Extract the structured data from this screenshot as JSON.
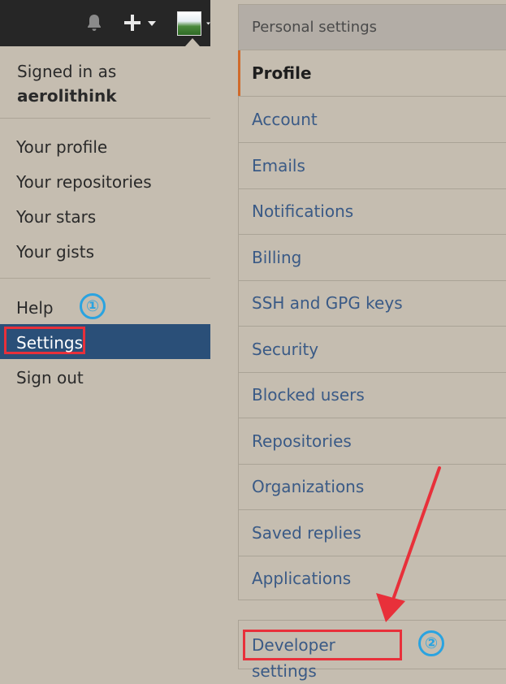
{
  "header": {
    "icons": [
      "bell-icon",
      "plus-icon",
      "chevron-down-icon",
      "avatar"
    ]
  },
  "dropdown": {
    "signed_in_label": "Signed in as",
    "username": "aerolithink",
    "items": [
      "Your profile",
      "Your repositories",
      "Your stars",
      "Your gists"
    ],
    "help": "Help",
    "settings": "Settings",
    "sign_out": "Sign out",
    "active_color": "#2a4f78"
  },
  "menu": {
    "heading": "Personal settings",
    "items": [
      "Profile",
      "Account",
      "Emails",
      "Notifications",
      "Billing",
      "SSH and GPG keys",
      "Security",
      "Blocked users",
      "Repositories",
      "Organizations",
      "Saved replies",
      "Applications"
    ],
    "selected": "Profile",
    "developer_settings": "Developer settings"
  },
  "annotations": {
    "step1": "①",
    "step2": "②",
    "highlight_color": "#e8303a",
    "badge_color": "#2aa3e0"
  }
}
